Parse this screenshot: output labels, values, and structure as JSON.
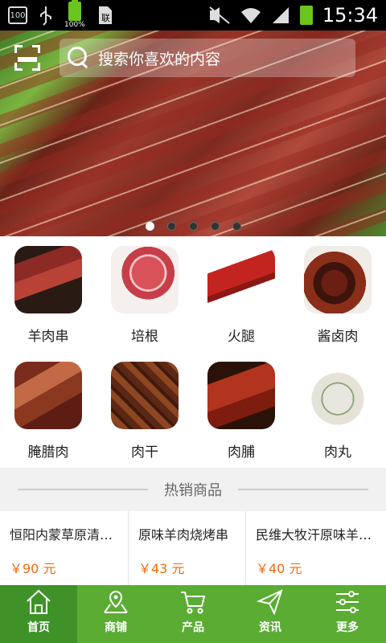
{
  "status_bar": {
    "time": "15:34",
    "battery_label": "100%",
    "notification_count": "100"
  },
  "search": {
    "placeholder": "搜索你喜欢的内容"
  },
  "banner": {
    "slides": 5,
    "active_slide": 1
  },
  "categories": [
    {
      "label": "羊肉串"
    },
    {
      "label": "培根"
    },
    {
      "label": "火腿"
    },
    {
      "label": "酱卤肉"
    },
    {
      "label": "腌腊肉"
    },
    {
      "label": "肉干"
    },
    {
      "label": "肉脯"
    },
    {
      "label": "肉丸"
    }
  ],
  "hot_section": {
    "title": "热销商品"
  },
  "products": [
    {
      "name": "恒阳内蒙草原清真羊肉串",
      "price": "￥90 元"
    },
    {
      "name": "原味羊肉烧烤串",
      "price": "￥43 元"
    },
    {
      "name": "民维大牧汗原味羊肉串",
      "price": "￥40 元"
    }
  ],
  "tabbar": {
    "items": [
      {
        "label": "首页",
        "icon": "home-icon",
        "active": true
      },
      {
        "label": "商铺",
        "icon": "map-icon",
        "active": false
      },
      {
        "label": "产品",
        "icon": "cart-icon",
        "active": false
      },
      {
        "label": "资讯",
        "icon": "send-icon",
        "active": false
      },
      {
        "label": "更多",
        "icon": "sliders-icon",
        "active": false
      }
    ]
  },
  "colors": {
    "brand_green": "#5aac33",
    "active_tab": "#3e9228",
    "price_orange": "#ef6b10"
  }
}
